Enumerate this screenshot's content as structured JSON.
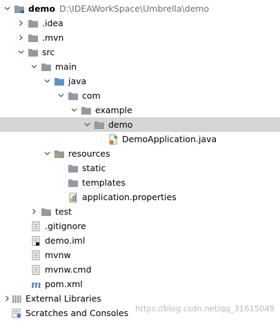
{
  "project": {
    "name": "demo",
    "path": "D:\\IDEAWorkSpace\\Umbrella\\demo"
  },
  "items": {
    "idea": ".idea",
    "mvn": ".mvn",
    "src": "src",
    "main": "main",
    "java": "java",
    "com": "com",
    "example": "example",
    "demo_pkg": "demo",
    "demo_app": "DemoApplication.java",
    "resources": "resources",
    "static": "static",
    "templates": "templates",
    "app_props": "application.properties",
    "test": "test",
    "gitignore": ".gitignore",
    "demo_iml": "demo.iml",
    "mvnw": "mvnw",
    "mvnw_cmd": "mvnw.cmd",
    "pom": "pom.xml",
    "external_libs": "External Libraries",
    "scratches": "Scratches and Consoles"
  },
  "watermark": "https://blog.csdn.net/qq_31615049",
  "colors": {
    "selection": "#d5d5d5",
    "folder": "#8f9aa5",
    "path_text": "#6e6e6e"
  }
}
